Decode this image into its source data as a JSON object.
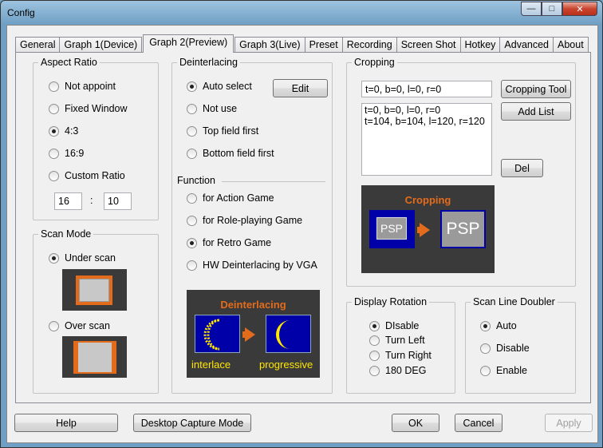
{
  "window": {
    "title": "Config"
  },
  "tabs": [
    {
      "label": "General"
    },
    {
      "label": "Graph 1(Device)"
    },
    {
      "label": "Graph 2(Preview)"
    },
    {
      "label": "Graph 3(Live)"
    },
    {
      "label": "Preset"
    },
    {
      "label": "Recording"
    },
    {
      "label": "Screen Shot"
    },
    {
      "label": "Hotkey"
    },
    {
      "label": "Advanced"
    },
    {
      "label": "About"
    }
  ],
  "aspect_ratio": {
    "title": "Aspect Ratio",
    "options": [
      "Not appoint",
      "Fixed Window",
      "4:3",
      "16:9",
      "Custom Ratio"
    ],
    "selected": "4:3",
    "custom_w": "16",
    "separator": ":",
    "custom_h": "10"
  },
  "scan_mode": {
    "title": "Scan Mode",
    "options": [
      "Under scan",
      "Over scan"
    ],
    "selected": "Under scan"
  },
  "deinterlacing": {
    "title": "Deinterlacing",
    "edit_label": "Edit",
    "options": [
      "Auto select",
      "Not use",
      "Top field first",
      "Bottom field first"
    ],
    "selected": "Auto select",
    "function_label": "Function",
    "functions": [
      "for Action Game",
      "for Role-playing Game",
      "for Retro Game",
      "HW Deinterlacing by VGA"
    ],
    "function_selected": "for Retro Game",
    "illustration": {
      "title": "Deinterlacing",
      "left": "interlace",
      "right": "progressive"
    }
  },
  "cropping": {
    "title": "Cropping",
    "current": "t=0, b=0, l=0, r=0",
    "list": [
      "t=0, b=0, l=0, r=0",
      "t=104, b=104, l=120, r=120"
    ],
    "tool_label": "Cropping Tool",
    "add_label": "Add List",
    "del_label": "Del",
    "illustration": {
      "title": "Cropping",
      "left": "PSP",
      "right": "PSP"
    }
  },
  "display_rotation": {
    "title": "Display Rotation",
    "options": [
      "DIsable",
      "Turn Left",
      "Turn Right",
      "180 DEG"
    ],
    "selected": "DIsable"
  },
  "scan_line_doubler": {
    "title": "Scan Line Doubler",
    "options": [
      "Auto",
      "Disable",
      "Enable"
    ],
    "selected": "Auto"
  },
  "footer": {
    "help": "Help",
    "desktop_capture": "Desktop Capture Mode",
    "ok": "OK",
    "cancel": "Cancel",
    "apply": "Apply"
  },
  "colors": {
    "accent_orange": "#e36c1c",
    "illus_blue": "#0000a8",
    "illus_bg": "#3a3a3a"
  }
}
